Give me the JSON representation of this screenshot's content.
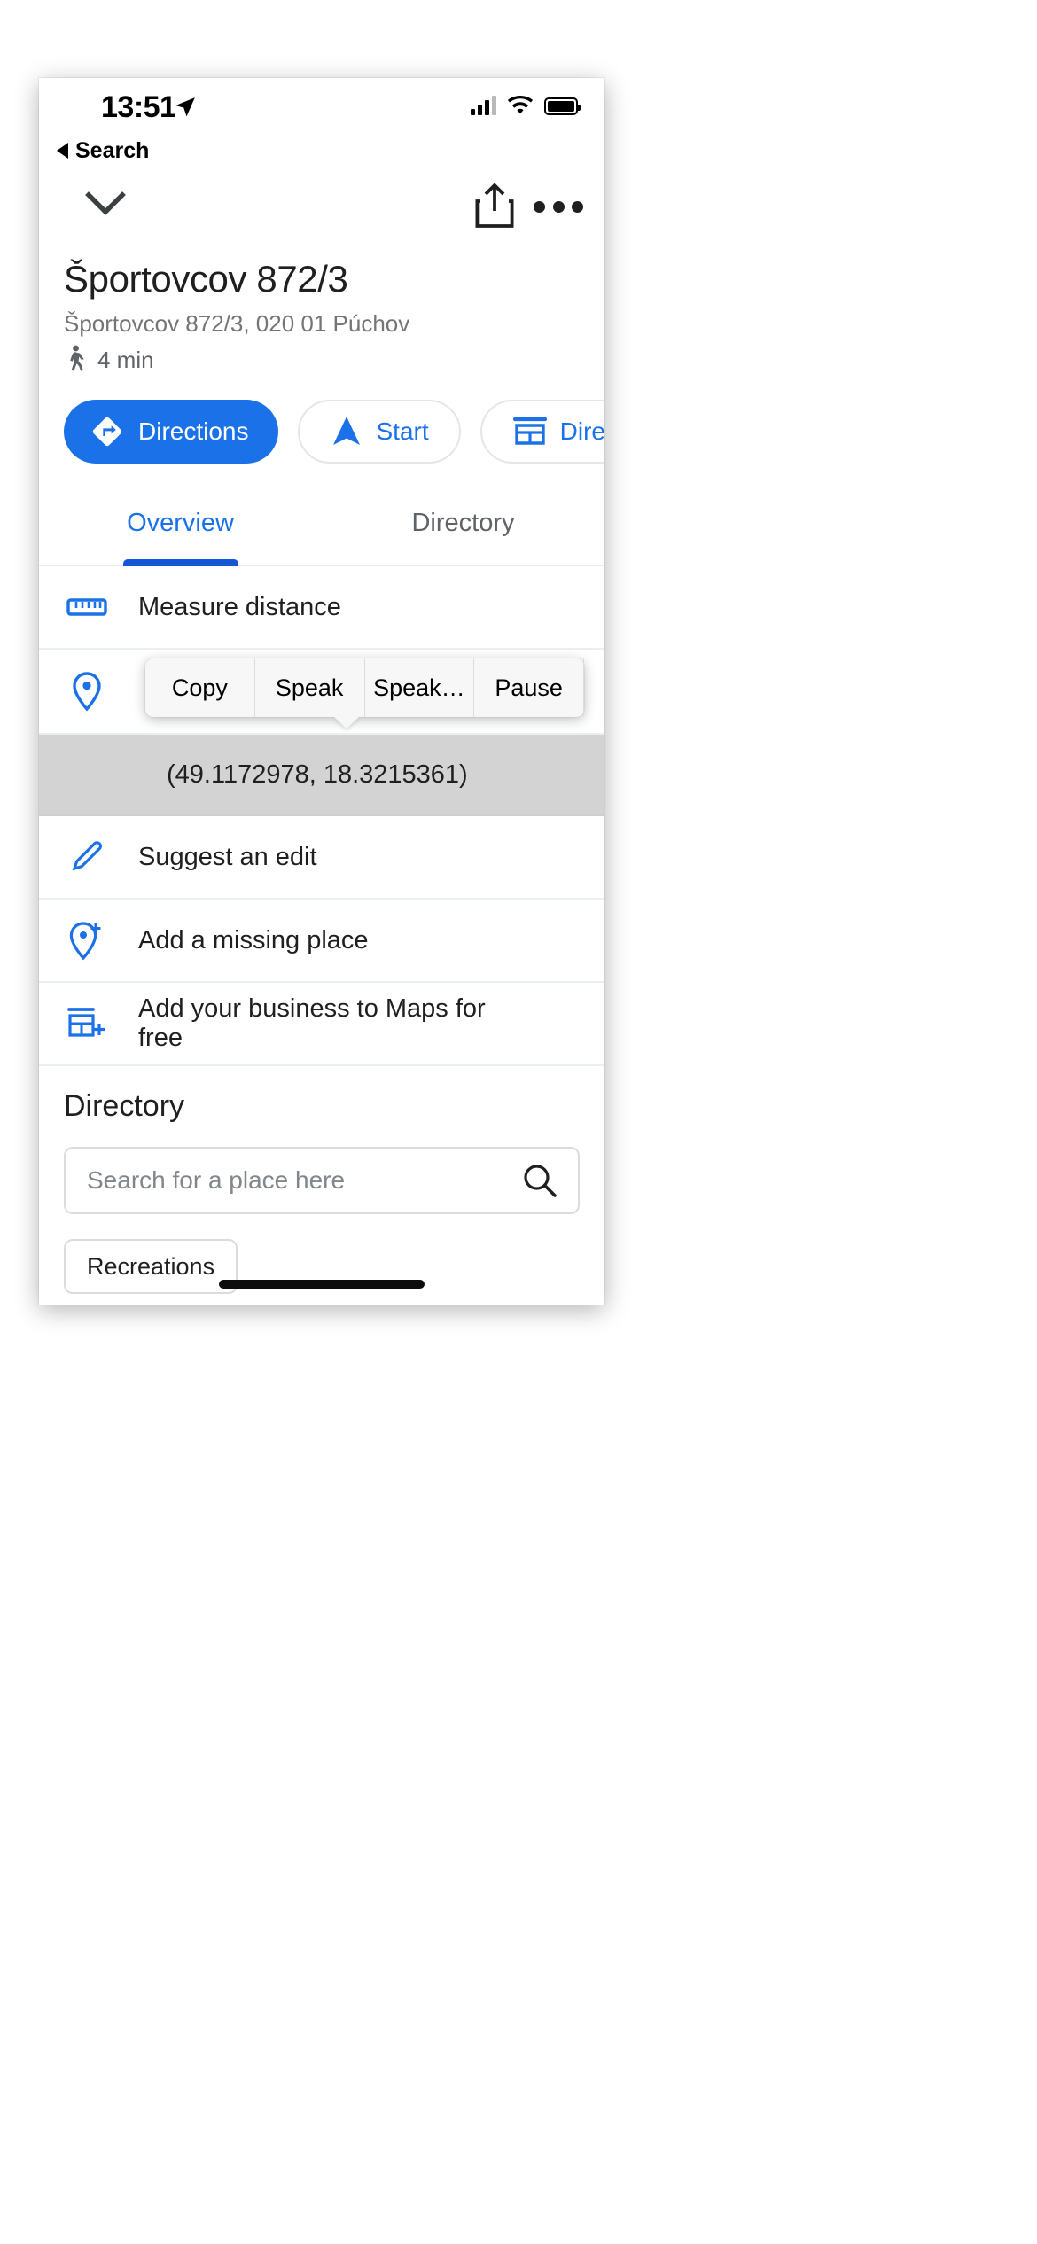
{
  "status_bar": {
    "time": "13:51",
    "location_icon": "location-arrow-icon",
    "signal_icon": "cellular-bars-icon",
    "wifi_icon": "wifi-icon",
    "battery_icon": "battery-full-icon"
  },
  "back": {
    "label": "Search",
    "icon": "back-triangle-icon"
  },
  "sheet_header": {
    "collapse_icon": "chevron-down-icon",
    "share_icon": "share-icon",
    "more_icon": "more-horizontal-icon"
  },
  "place": {
    "title": "Športovcov 872/3",
    "address": "Športovcov 872/3, 020 01 Púchov",
    "walk_icon": "walking-person-icon",
    "walk_time": "4 min"
  },
  "action_chips": [
    {
      "label": "Directions",
      "icon": "directions-diamond-icon",
      "style": "primary"
    },
    {
      "label": "Start",
      "icon": "navigation-arrow-icon",
      "style": "ghost"
    },
    {
      "label": "Directory",
      "icon": "storefront-icon",
      "style": "ghost"
    }
  ],
  "tabs": [
    {
      "label": "Overview",
      "active": true
    },
    {
      "label": "Directory",
      "active": false
    }
  ],
  "rows": [
    {
      "label": "Measure distance",
      "icon": "ruler-icon",
      "trailing": ""
    },
    {
      "label": "",
      "icon": "map-pin-icon",
      "trailing": "info-circle-icon"
    },
    {
      "label": "Suggest an edit",
      "icon": "pencil-icon",
      "trailing": ""
    },
    {
      "label": "Add a missing place",
      "icon": "add-place-pin-icon",
      "trailing": ""
    },
    {
      "label": "Add your business to Maps for free",
      "icon": "add-business-icon",
      "trailing": ""
    }
  ],
  "coordinates": {
    "value": "(49.1172978, 18.3215361)",
    "selected": true
  },
  "edit_popup": {
    "items": [
      {
        "label": "Copy"
      },
      {
        "label": "Speak"
      },
      {
        "label": "Speak…"
      },
      {
        "label": "Pause"
      }
    ]
  },
  "directory": {
    "title": "Directory",
    "search_placeholder": "Search for a place here",
    "search_value": "",
    "search_icon": "search-icon",
    "filter_chips": [
      {
        "label": "Recreations"
      }
    ]
  },
  "photos": [
    {
      "name": "place-photo-1"
    }
  ],
  "colors": {
    "accent_blue": "#1b72e8",
    "tab_underline": "#1558d6",
    "text_primary": "#1f1f1f",
    "text_secondary": "#757575",
    "selection_gray": "#d3d3d3",
    "popup_bg": "#f7f7f7"
  },
  "home_indicator": "home-indicator"
}
